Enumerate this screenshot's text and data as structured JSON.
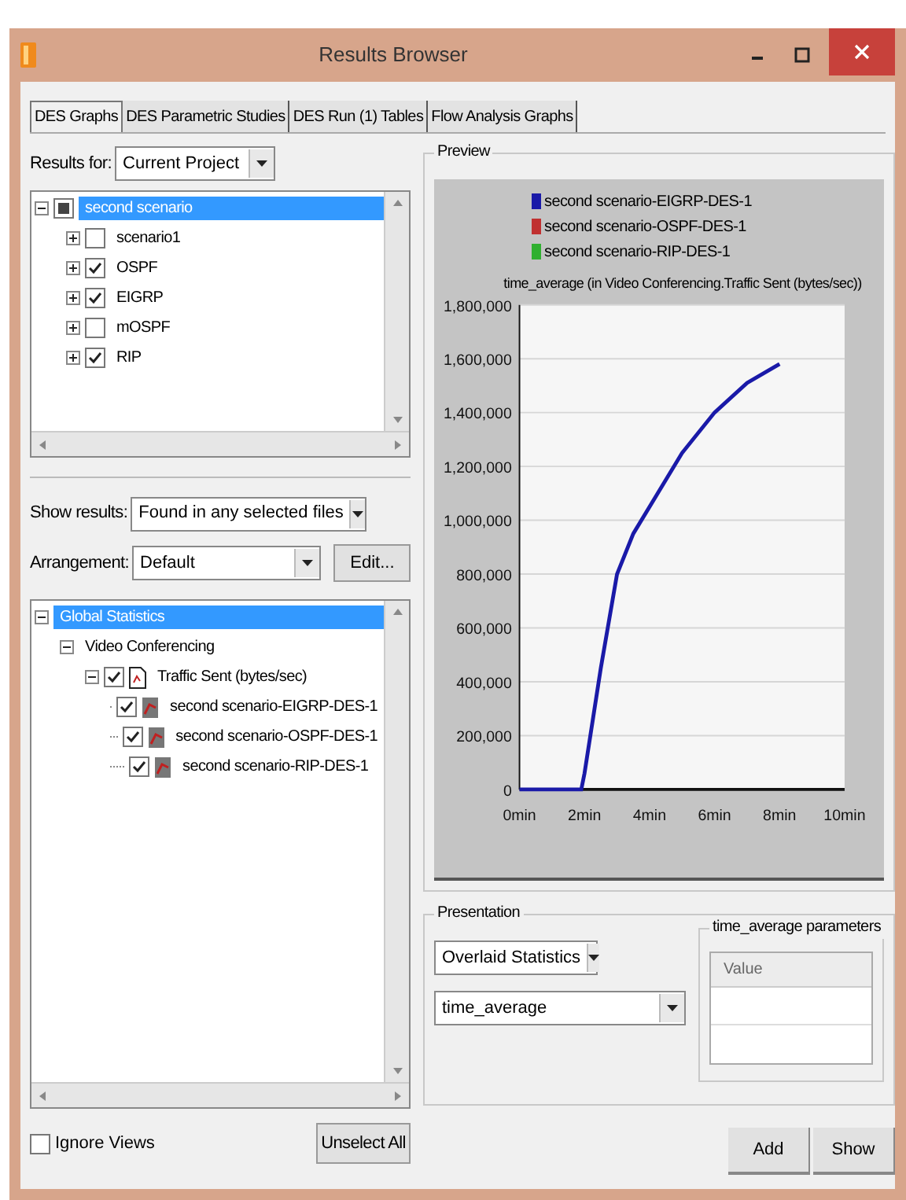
{
  "window": {
    "title": "Results Browser"
  },
  "tabs": [
    {
      "label": "DES Graphs",
      "selected": true
    },
    {
      "label": "DES Parametric Studies",
      "selected": false
    },
    {
      "label": "DES Run (1) Tables",
      "selected": false
    },
    {
      "label": "Flow Analysis Graphs",
      "selected": false
    }
  ],
  "results_for": {
    "label": "Results for:",
    "value": "Current Project"
  },
  "scenario_tree": [
    {
      "label": "second scenario",
      "selected": true,
      "expanded": true,
      "checked": true,
      "indeterminate": true,
      "children": [
        {
          "label": "scenario1",
          "selected": false,
          "expanded": false,
          "checked": false,
          "indeterminate": false
        },
        {
          "label": "OSPF",
          "selected": false,
          "expanded": false,
          "checked": true,
          "indeterminate": false
        },
        {
          "label": "EIGRP",
          "selected": false,
          "expanded": false,
          "checked": true,
          "indeterminate": false
        },
        {
          "label": "mOSPF",
          "selected": false,
          "expanded": false,
          "checked": false,
          "indeterminate": false
        },
        {
          "label": "RIP",
          "selected": false,
          "expanded": false,
          "checked": true,
          "indeterminate": false
        }
      ]
    }
  ],
  "show_results": {
    "label": "Show results:",
    "value": "Found in any selected files"
  },
  "arrangement": {
    "label": "Arrangement:",
    "value": "Default",
    "button": "Edit..."
  },
  "statistics_tree": [
    {
      "label": "Global Statistics",
      "selected": true,
      "expanded": true,
      "children": [
        {
          "label": "Video Conferencing",
          "selected": false,
          "expanded": true,
          "children": [
            {
              "label": "Traffic Sent (bytes/sec)",
              "kind": "statistic",
              "selected": false,
              "expanded": true,
              "checked": true,
              "children": [
                {
                  "label": "second scenario-EIGRP-DES-1",
                  "kind": "run",
                  "selected": false,
                  "checked": true
                },
                {
                  "label": "second scenario-OSPF-DES-1",
                  "kind": "run",
                  "selected": false,
                  "checked": true
                },
                {
                  "label": "second scenario-RIP-DES-1",
                  "kind": "run",
                  "selected": false,
                  "checked": true
                }
              ]
            }
          ]
        }
      ]
    }
  ],
  "ignore_views": {
    "label": "Ignore Views",
    "checked": false
  },
  "unselect_all": "Unselect All",
  "preview": {
    "title": "Preview",
    "chart_data": {
      "type": "line",
      "title": "time_average (in Video Conferencing.Traffic Sent (bytes/sec))",
      "x": [
        0,
        1,
        1.9,
        2,
        2.5,
        3,
        3.5,
        4,
        5,
        6,
        7,
        8
      ],
      "series": [
        {
          "name": "second scenario-EIGRP-DES-1",
          "color": "#1a1aa8",
          "values": [
            0,
            0,
            0,
            60000,
            450000,
            800000,
            950000,
            1050000,
            1250000,
            1400000,
            1510000,
            1580000
          ]
        },
        {
          "name": "second scenario-OSPF-DES-1",
          "color": "#c03030",
          "values": [
            null,
            null,
            null,
            null,
            null,
            null,
            null,
            null,
            null,
            null,
            null,
            null
          ]
        },
        {
          "name": "second scenario-RIP-DES-1",
          "color": "#30b030",
          "values": [
            null,
            null,
            null,
            null,
            null,
            null,
            null,
            null,
            null,
            null,
            null,
            null
          ]
        }
      ],
      "grid": true,
      "legend": "top",
      "xlim": [
        0,
        10
      ],
      "ylim": [
        0,
        1800000
      ],
      "xticks": [
        {
          "value": 0,
          "label": "0min"
        },
        {
          "value": 2,
          "label": "2min"
        },
        {
          "value": 4,
          "label": "4min"
        },
        {
          "value": 6,
          "label": "6min"
        },
        {
          "value": 8,
          "label": "8min"
        },
        {
          "value": 10,
          "label": "10min"
        }
      ],
      "yticks": [
        {
          "value": 0,
          "label": "0"
        },
        {
          "value": 200000,
          "label": "200,000"
        },
        {
          "value": 400000,
          "label": "400,000"
        },
        {
          "value": 600000,
          "label": "600,000"
        },
        {
          "value": 800000,
          "label": "800,000"
        },
        {
          "value": 1000000,
          "label": "1,000,000"
        },
        {
          "value": 1200000,
          "label": "1,200,000"
        },
        {
          "value": 1400000,
          "label": "1,400,000"
        },
        {
          "value": 1600000,
          "label": "1,600,000"
        },
        {
          "value": 1800000,
          "label": "1,800,000"
        }
      ]
    }
  },
  "presentation": {
    "title": "Presentation",
    "mode": "Overlaid Statistics",
    "filter": "time_average",
    "parameters": {
      "title": "time_average parameters",
      "column": "Value"
    }
  },
  "buttons": [
    "Add",
    "Show"
  ]
}
